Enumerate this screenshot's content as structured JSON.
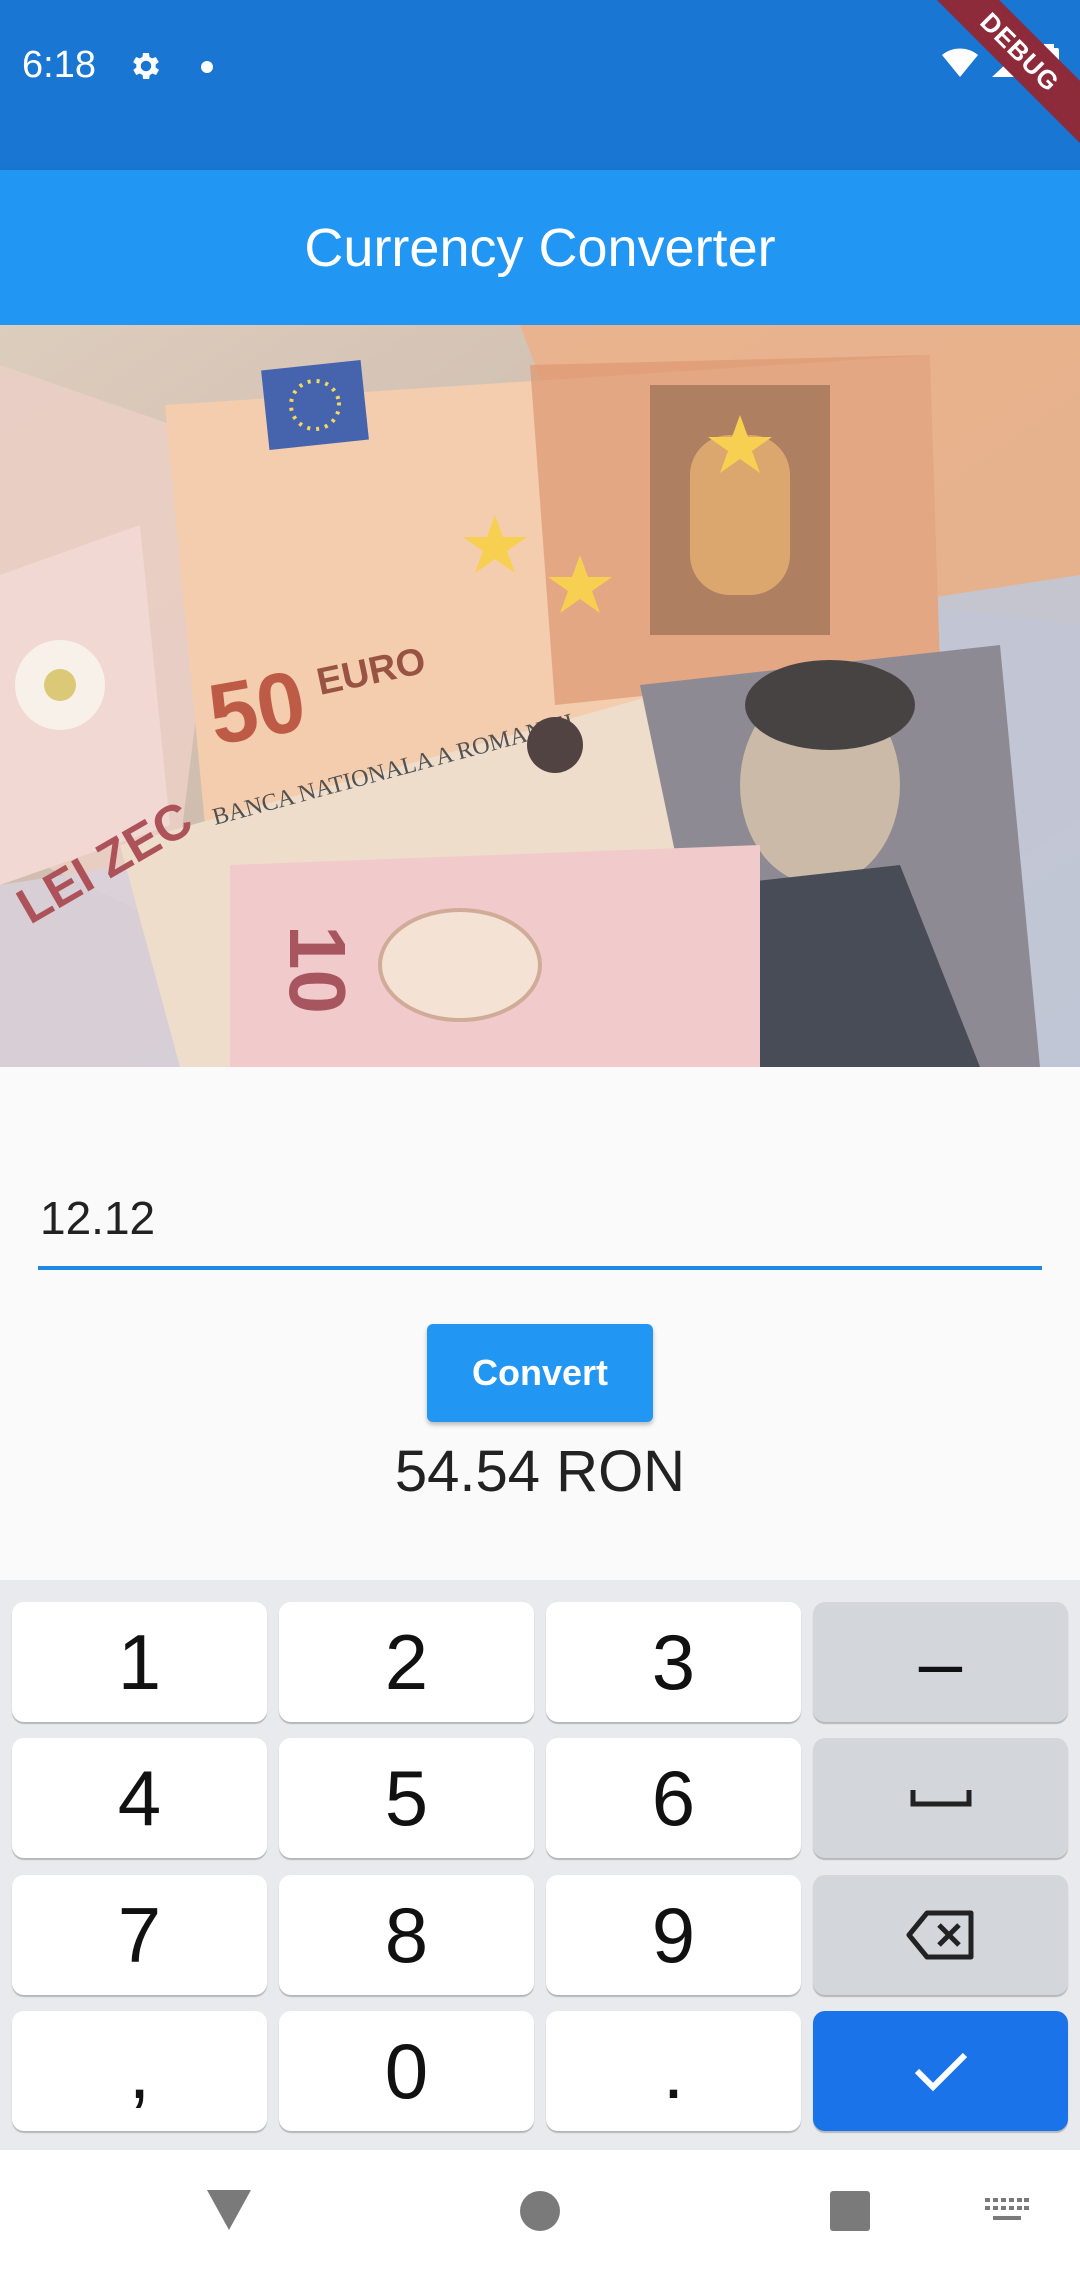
{
  "status_bar": {
    "time": "6:18",
    "debug_label": "DEBUG"
  },
  "app_bar": {
    "title": "Currency Converter"
  },
  "hero": {
    "description_icon": "banknotes-image"
  },
  "form": {
    "amount_value": "12.12",
    "convert_label": "Convert",
    "result_text": "54.54 RON"
  },
  "keyboard": {
    "row1": [
      "1",
      "2",
      "3",
      "–"
    ],
    "row2": [
      "4",
      "5",
      "6"
    ],
    "row3": [
      "7",
      "8",
      "9"
    ],
    "row4": [
      ",",
      "0",
      "."
    ]
  },
  "colors": {
    "status_bar": "#1976d2",
    "app_bar": "#2196f3",
    "accent": "#1e88e5",
    "keyboard_done": "#1a73e8"
  }
}
